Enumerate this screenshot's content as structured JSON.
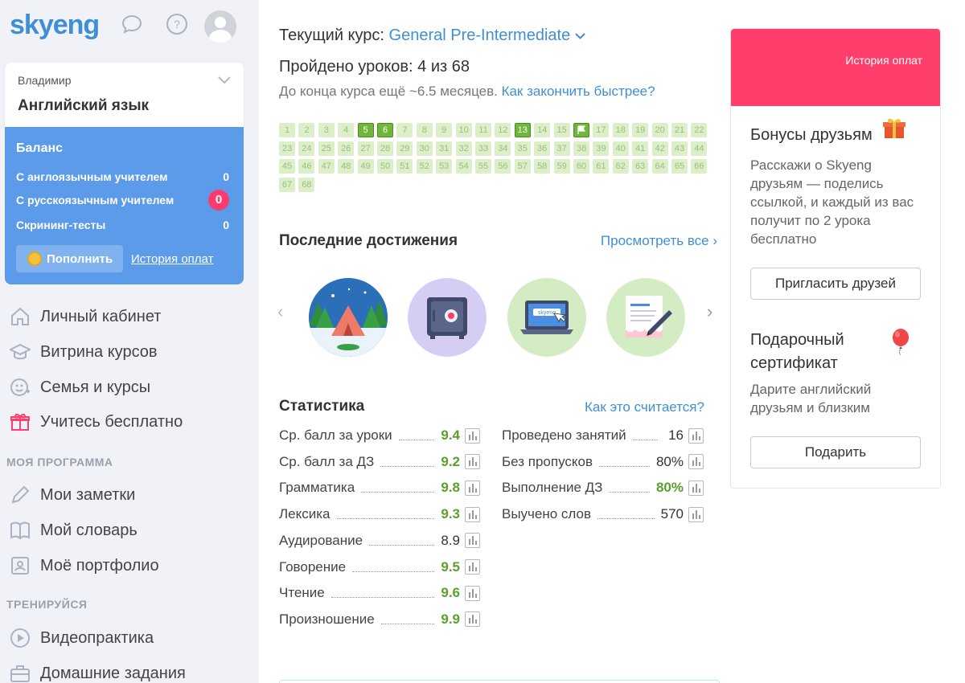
{
  "header": {
    "logo_sky": "sky",
    "logo_eng": "eng"
  },
  "profile": {
    "name": "Владимир",
    "course": "Английский язык"
  },
  "balance": {
    "title": "Баланс",
    "rows": [
      {
        "label": "С англоязычным учителем",
        "value": "0"
      },
      {
        "label": "С русскоязычным учителем",
        "value": "0"
      },
      {
        "label": "Скрининг-тесты",
        "value": "0"
      }
    ],
    "topup_label": "Пополнить",
    "history_label": "История оплат"
  },
  "nav": {
    "main_items": [
      {
        "label": "Личный кабинет",
        "icon": "home-icon"
      },
      {
        "label": "Витрина курсов",
        "icon": "graduation-cap-icon"
      },
      {
        "label": "Семья и курсы",
        "icon": "family-icon"
      },
      {
        "label": "Учитесь бесплатно",
        "icon": "gift-icon"
      }
    ],
    "section_program": "МОЯ ПРОГРАММА",
    "program_items": [
      {
        "label": "Мои заметки",
        "icon": "pencil-icon"
      },
      {
        "label": "Мой словарь",
        "icon": "book-icon"
      },
      {
        "label": "Моё портфолио",
        "icon": "portfolio-icon"
      }
    ],
    "section_train": "ТРЕНИРУЙСЯ",
    "train_items": [
      {
        "label": "Видеопрактика",
        "icon": "play-icon"
      },
      {
        "label": "Домашние задания",
        "icon": "briefcase-icon"
      }
    ]
  },
  "course": {
    "current_label": "Текущий курс:",
    "current_name": "General Pre-Intermediate",
    "lessons_text": "Пройдено уроков: 4 из 68",
    "remaining_text": "До конца курса ещё ~6.5 месяцев.",
    "faster_link": "Как закончить быстрее?",
    "total_lessons": 68,
    "done_lessons": [
      5,
      6,
      13
    ],
    "flag_lesson": 16
  },
  "achievements": {
    "title": "Последние достижения",
    "view_all": "Просмотреть все ›",
    "badges": [
      {
        "name": "camping-badge",
        "color": "#2a7fc9"
      },
      {
        "name": "safe-badge",
        "color": "#cfc6f2"
      },
      {
        "name": "laptop-badge",
        "color": "#d4ecc4"
      },
      {
        "name": "document-badge",
        "color": "#d4ecc4"
      }
    ],
    "badge_screen_text": "skyeng"
  },
  "stats": {
    "title": "Статистика",
    "how_link": "Как это считается?",
    "left": [
      {
        "label": "Ср. балл за уроки",
        "value": "9.4",
        "green": true
      },
      {
        "label": "Ср. балл за ДЗ",
        "value": "9.2",
        "green": true
      },
      {
        "label": "Грамматика",
        "value": "9.8",
        "green": true
      },
      {
        "label": "Лексика",
        "value": "9.3",
        "green": true
      },
      {
        "label": "Аудирование",
        "value": "8.9",
        "green": false
      },
      {
        "label": "Говорение",
        "value": "9.5",
        "green": true
      },
      {
        "label": "Чтение",
        "value": "9.6",
        "green": true
      },
      {
        "label": "Произношение",
        "value": "9.9",
        "green": true
      }
    ],
    "right": [
      {
        "label": "Проведено занятий",
        "value": "16",
        "green": false
      },
      {
        "label": "Без пропусков",
        "value": "80%",
        "green": false
      },
      {
        "label": "Выполнение ДЗ",
        "value": "80%",
        "green": true
      },
      {
        "label": "Выучено слов",
        "value": "570",
        "green": false
      }
    ]
  },
  "right_panel": {
    "banner_link": "История оплат",
    "bonus_title": "Бонусы друзьям",
    "bonus_text": "Расскажи о Skyeng друзьям — поделись ссылкой, и каждый из вас получит по 2 урока бесплатно",
    "invite_button": "Пригласить друзей",
    "gift_title": "Подарочный сертификат",
    "gift_text": "Дарите английский друзьям и близким",
    "gift_button": "Подарить"
  },
  "colors": {
    "brand_blue": "#3f8fd6",
    "balance_blue": "#5b9bea",
    "accent_red": "#ff3e6c",
    "score_green": "#5aa02c"
  }
}
